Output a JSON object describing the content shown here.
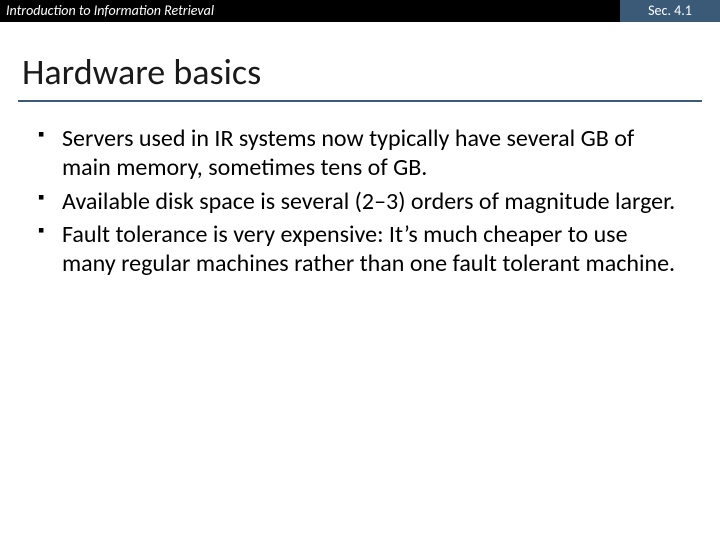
{
  "header": {
    "course": "Introduction to Information Retrieval",
    "section": "Sec. 4.1"
  },
  "title": "Hardware basics",
  "bullets": [
    "Servers used in IR systems now typically have several GB of main memory, sometimes tens of GB.",
    "Available disk space is several (2–3) orders of magnitude larger.",
    "Fault tolerance is very expensive: It’s much cheaper to use many regular machines rather than one fault tolerant machine."
  ]
}
